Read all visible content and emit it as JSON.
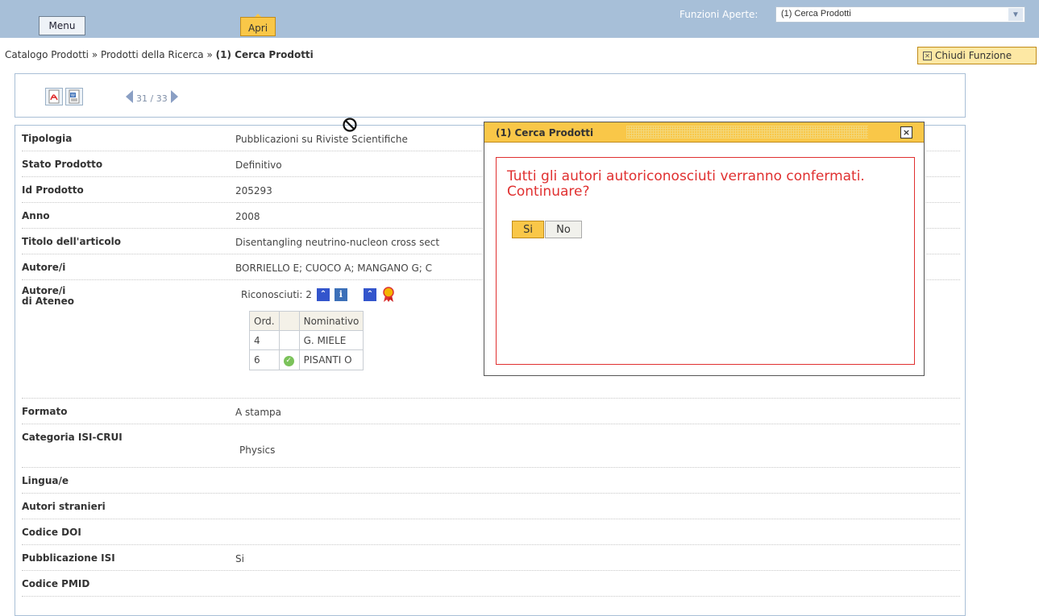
{
  "topbar": {
    "menu_label": "Menu",
    "apri_label": "Apri",
    "funzioni_label": "Funzioni Aperte:",
    "funzioni_selected": "(1) Cerca Prodotti"
  },
  "breadcrumb": {
    "part1": "Catalogo Prodotti",
    "sep": "»",
    "part2": "Prodotti della Ricerca",
    "current": "(1) Cerca Prodotti"
  },
  "chiudi_label": "Chiudi Funzione",
  "pager": {
    "text": "31 / 33"
  },
  "fields": [
    {
      "label": "Tipologia",
      "value": "Pubblicazioni su Riviste Scientifiche"
    },
    {
      "label": "Stato Prodotto",
      "value": "Definitivo"
    },
    {
      "label": "Id Prodotto",
      "value": "205293"
    },
    {
      "label": "Anno",
      "value": "2008"
    },
    {
      "label": "Titolo dell'articolo",
      "value": "Disentangling neutrino-nucleon cross sect"
    },
    {
      "label": "Autore/i",
      "value": "BORRIELLO E; CUOCO A; MANGANO G; C"
    },
    {
      "label": "Autore/i\ndi Ateneo",
      "value": ""
    },
    {
      "label": "Formato",
      "value": "A stampa"
    },
    {
      "label": "Categoria ISI-CRUI",
      "value": "Physics"
    },
    {
      "label": "Lingua/e",
      "value": ""
    },
    {
      "label": "Autori stranieri",
      "value": ""
    },
    {
      "label": "Codice DOI",
      "value": ""
    },
    {
      "label": "Pubblicazione ISI",
      "value": "Si"
    },
    {
      "label": "Codice PMID",
      "value": ""
    }
  ],
  "autori_ateneo": {
    "riconosciuti_label": "Riconosciuti: 2",
    "headers": [
      "Ord.",
      "",
      "Nominativo"
    ],
    "rows": [
      {
        "ord": "4",
        "nominativo": "G. MIELE",
        "checked": false
      },
      {
        "ord": "6",
        "nominativo": "PISANTI O",
        "checked": true
      }
    ]
  },
  "dialog": {
    "title": "(1) Cerca Prodotti",
    "close": "×",
    "message": "Tutti gli autori autoriconosciuti verranno confermati. Continuare?",
    "yes_label": "Si",
    "no_label": "No"
  },
  "colors": {
    "topbar": "#a7bfd8",
    "accent": "#f9c748",
    "dialog_text": "#e03030"
  }
}
